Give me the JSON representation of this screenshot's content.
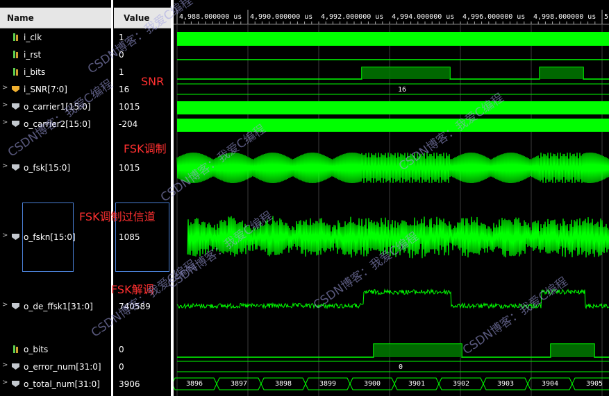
{
  "header": {
    "name_label": "Name",
    "value_label": "Value"
  },
  "ruler": {
    "labels": [
      "4,988.000000 us",
      "4,990.000000 us",
      "4,992.000000 us",
      "4,994.000000 us",
      "4,996.000000 us",
      "4,998.000000 us",
      "5,0"
    ]
  },
  "signals": [
    {
      "name": "i_clk",
      "value": "1",
      "icon": "bit-signal-icon"
    },
    {
      "name": "i_rst",
      "value": "0",
      "icon": "bit-signal-icon"
    },
    {
      "name": "i_bits",
      "value": "1",
      "icon": "bit-signal-icon"
    },
    {
      "name": "i_SNR[7:0]",
      "value": "16",
      "icon": "bus-signal-icon",
      "bus_label": "16"
    },
    {
      "name": "o_carrier1[15:0]",
      "value": "1015",
      "icon": "bus-signal-icon"
    },
    {
      "name": "o_carrier2[15:0]",
      "value": "-204",
      "icon": "bus-signal-icon"
    },
    {
      "name": "o_fsk[15:0]",
      "value": "1015",
      "icon": "bus-signal-icon"
    },
    {
      "name": "o_fskn[15:0]",
      "value": "1085",
      "icon": "bus-signal-icon"
    },
    {
      "name": "o_de_ffsk1[31:0]",
      "value": "740589",
      "icon": "bus-signal-icon"
    },
    {
      "name": "o_bits",
      "value": "0",
      "icon": "bit-signal-icon"
    },
    {
      "name": "o_error_num[31:0]",
      "value": "0",
      "icon": "bus-signal-icon",
      "bus_label": "0"
    },
    {
      "name": "o_total_num[31:0]",
      "value": "3906",
      "icon": "bus-signal-icon",
      "segments": [
        "3896",
        "3897",
        "3898",
        "3899",
        "3900",
        "3901",
        "3902",
        "3903",
        "3904",
        "3905"
      ]
    }
  ],
  "annotations": {
    "snr": "SNR",
    "fsk_mod": "FSK调制",
    "fsk_channel": "FSK调制过信道",
    "fsk_demod": "FSK解调"
  },
  "watermarks": [
    "CSDN博客：我爱C编程",
    "CSDN博客：我爱C编程",
    "CSDN博客：我爱C编程",
    "CSDN博客：我爱C编程",
    "CSDN博客：我爱C编程",
    "CSDN博客：我爱C编程",
    "CSDN博客：我爱C编程",
    "CSDN博客：我爱C编程"
  ],
  "colors": {
    "wave": "#00ff00",
    "wave_fill": "#00b400",
    "background": "#000000",
    "annotation": "#ff3030",
    "grid": "#3c3c3c"
  }
}
